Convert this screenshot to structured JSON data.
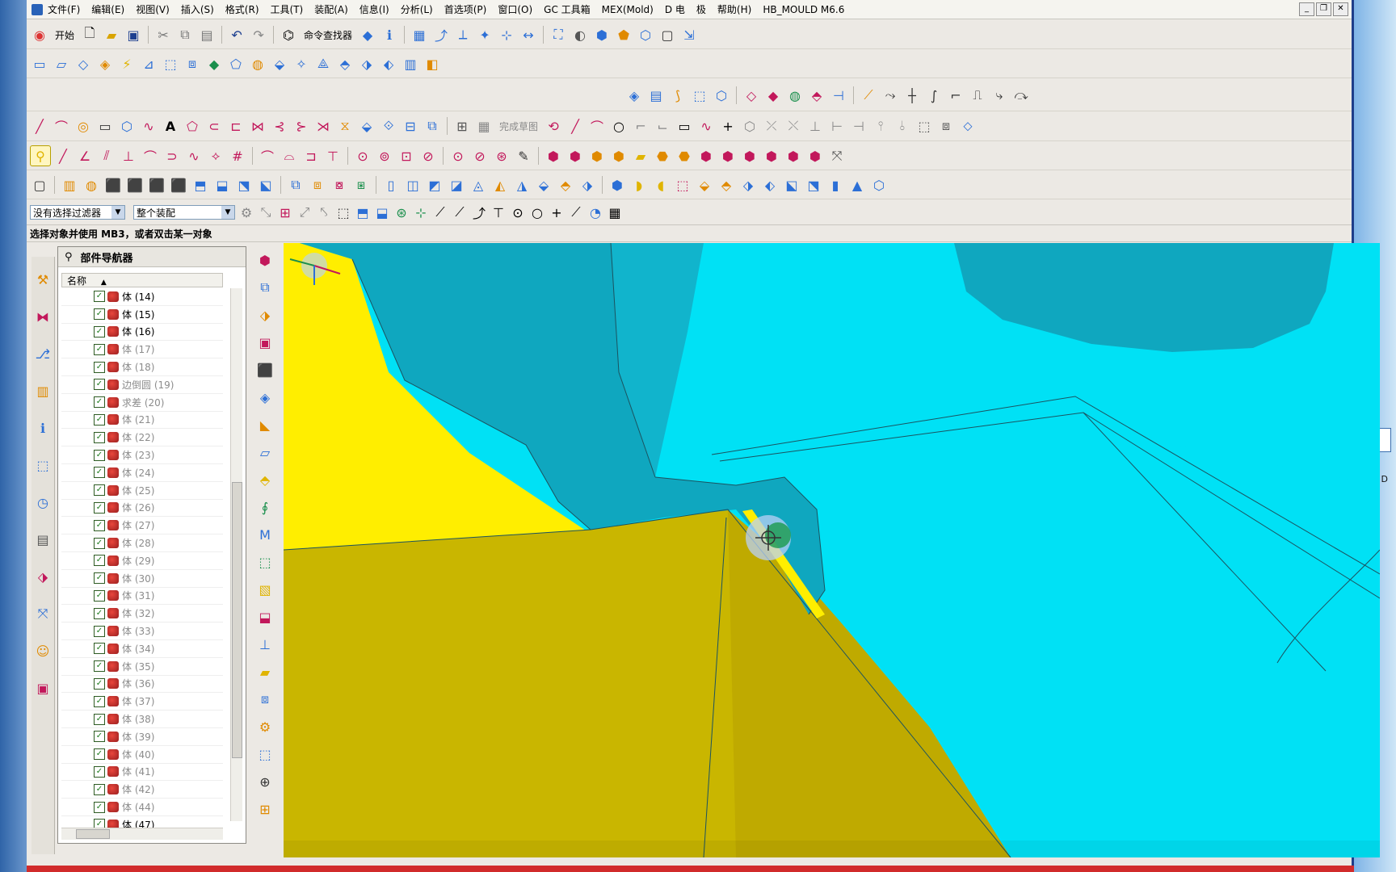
{
  "menu": {
    "items": [
      "文件(F)",
      "编辑(E)",
      "视图(V)",
      "插入(S)",
      "格式(R)",
      "工具(T)",
      "装配(A)",
      "信息(I)",
      "分析(L)",
      "首选项(P)",
      "窗口(O)",
      "GC 工具箱",
      "MEX(Mold)",
      "D 电",
      "极",
      "帮助(H)",
      "HB_MOULD M6.6"
    ]
  },
  "toolbar": {
    "start_label": "开始",
    "command_finder_label": "命令查找器",
    "finish_sketch_label": "完成草图"
  },
  "selection": {
    "filter_value": "没有选择过滤器",
    "scope_value": "整个装配"
  },
  "status": {
    "prompt": "选择对象并使用 MB3，或者双击某一对象"
  },
  "navigator": {
    "title": "部件导航器",
    "column_name": "名称",
    "rows": [
      {
        "label": "体 (14)",
        "dim": false
      },
      {
        "label": "体 (15)",
        "dim": false
      },
      {
        "label": "体 (16)",
        "dim": false
      },
      {
        "label": "体 (17)",
        "dim": true
      },
      {
        "label": "体 (18)",
        "dim": true
      },
      {
        "label": "边倒圆 (19)",
        "dim": true
      },
      {
        "label": "求差 (20)",
        "dim": true
      },
      {
        "label": "体 (21)",
        "dim": true
      },
      {
        "label": "体 (22)",
        "dim": true
      },
      {
        "label": "体 (23)",
        "dim": true
      },
      {
        "label": "体 (24)",
        "dim": true
      },
      {
        "label": "体 (25)",
        "dim": true
      },
      {
        "label": "体 (26)",
        "dim": true
      },
      {
        "label": "体 (27)",
        "dim": true
      },
      {
        "label": "体 (28)",
        "dim": true
      },
      {
        "label": "体 (29)",
        "dim": true
      },
      {
        "label": "体 (30)",
        "dim": true
      },
      {
        "label": "体 (31)",
        "dim": true
      },
      {
        "label": "体 (32)",
        "dim": true
      },
      {
        "label": "体 (33)",
        "dim": true
      },
      {
        "label": "体 (34)",
        "dim": true
      },
      {
        "label": "体 (35)",
        "dim": true
      },
      {
        "label": "体 (36)",
        "dim": true
      },
      {
        "label": "体 (37)",
        "dim": true
      },
      {
        "label": "体 (38)",
        "dim": true
      },
      {
        "label": "体 (39)",
        "dim": true
      },
      {
        "label": "体 (40)",
        "dim": true
      },
      {
        "label": "体 (41)",
        "dim": true
      },
      {
        "label": "体 (42)",
        "dim": true
      },
      {
        "label": "体 (44)",
        "dim": true
      },
      {
        "label": "体 (47)",
        "dim": false
      }
    ]
  },
  "desktop": {
    "right_label": "新建 D"
  },
  "colors": {
    "viewport_cyan": "#00e1f5",
    "teal_body": "#0fa7bf",
    "yellow_face": "#ffee00",
    "olive_face": "#c9b600"
  }
}
